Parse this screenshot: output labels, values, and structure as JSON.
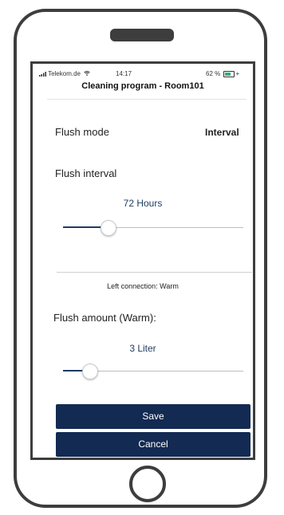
{
  "status_bar": {
    "carrier": "Telekom.de",
    "time": "14:17",
    "battery": "62 %",
    "battery_level": 0.62,
    "signal_icon": "signal-bars-icon",
    "wifi_icon": "wifi-icon",
    "battery_icon": "battery-icon"
  },
  "nav": {
    "title": "Cleaning program - Room101"
  },
  "flush_mode": {
    "label": "Flush mode",
    "value": "Interval"
  },
  "flush_interval": {
    "label": "Flush interval",
    "value_text": "72 Hours",
    "slider_position": 0.25
  },
  "connection_note": "Left connection: Warm",
  "flush_amount": {
    "label": "Flush amount (Warm):",
    "value_text": "3 Liter",
    "slider_position": 0.15
  },
  "buttons": {
    "save": "Save",
    "cancel": "Cancel"
  },
  "colors": {
    "accent": "#132a52",
    "value_text": "#1f3a5f",
    "phone_frame": "#3d3d3d"
  }
}
